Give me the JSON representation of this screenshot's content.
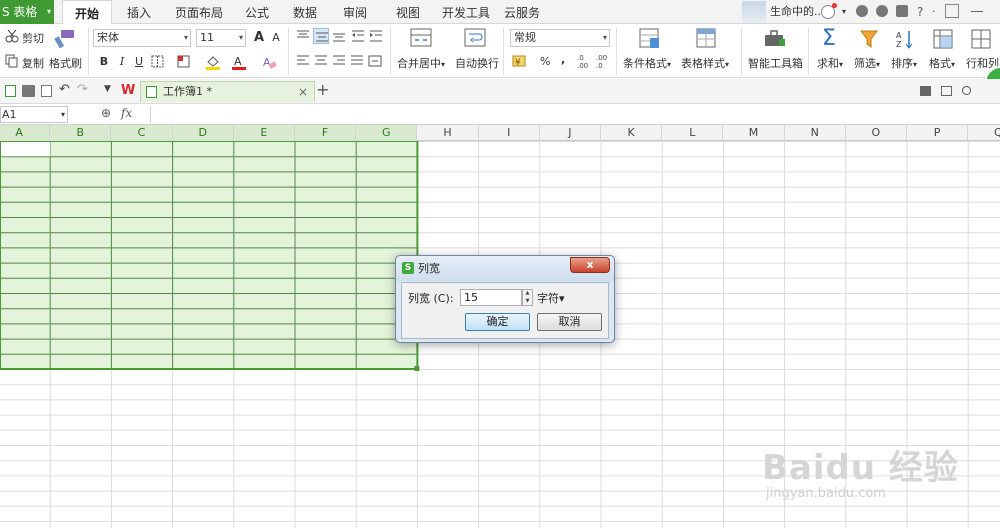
{
  "app": {
    "name": "S 表格",
    "menu_caret": "▾"
  },
  "tabs": [
    {
      "label": "开始",
      "active": true
    },
    {
      "label": "插入"
    },
    {
      "label": "页面布局"
    },
    {
      "label": "公式"
    },
    {
      "label": "数据"
    },
    {
      "label": "审阅"
    },
    {
      "label": "视图"
    },
    {
      "label": "开发工具"
    },
    {
      "label": "云服务"
    }
  ],
  "user": {
    "name": "生命中的...",
    "help": "?"
  },
  "ribbon": {
    "cut": "剪切",
    "copy": "复制",
    "format_painter": "格式刷",
    "font_name": "宋体",
    "font_size": "11",
    "bold": "B",
    "italic": "I",
    "underline": "U",
    "merge_center": "合并居中",
    "wrap_text": "自动换行",
    "number_format": "常规",
    "percent": "%",
    "comma": ",",
    "cond_format": "条件格式",
    "table_style": "表格样式",
    "toolbox": "智能工具箱",
    "sum": "求和",
    "filter": "筛选",
    "sort": "排序",
    "format": "格式",
    "rowcol": "行和列",
    "dropdown": "▾"
  },
  "quickbar": {
    "doc_tab": "工作簿1 *",
    "close": "×",
    "add": "+"
  },
  "formula_bar": {
    "cell_ref": "A1",
    "fx": "fx",
    "zoom_icon": "⊕"
  },
  "columns": [
    "A",
    "B",
    "C",
    "D",
    "E",
    "F",
    "G",
    "H",
    "I",
    "J",
    "K",
    "L",
    "M",
    "N",
    "O",
    "P",
    "Q"
  ],
  "selected_columns": [
    "A",
    "B",
    "C",
    "D",
    "E",
    "F",
    "G"
  ],
  "selection_rows": 15,
  "dialog": {
    "title": "列宽",
    "label": "列宽 (C):",
    "value": "15",
    "unit": "字符▾",
    "ok": "确定",
    "cancel": "取消",
    "close": "x"
  },
  "watermark": {
    "text": "Baidu 经验",
    "url": "jingyan.baidu.com"
  },
  "colors": {
    "accent": "#3f9a34",
    "selection_fill": "#e4f4da",
    "selection_border": "#4b9a35"
  }
}
